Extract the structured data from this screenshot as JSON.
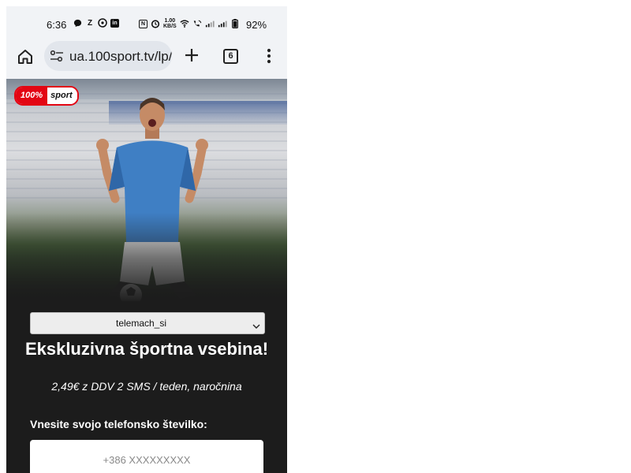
{
  "status_bar": {
    "time": "6:36",
    "net_speed_value": "1.00",
    "net_speed_unit": "KB/S",
    "battery_percent": "92%"
  },
  "browser": {
    "url": "ua.100sport.tv/lp/",
    "tab_count": "6"
  },
  "brand": {
    "logo_part1": "100%",
    "logo_part2": "sport",
    "accent_color": "#e30613"
  },
  "form": {
    "operator_selected": "telemach_si",
    "headline": "Ekskluzivna športna vsebina!",
    "price_text": "2,49€ z DDV 2 SMS / teden, naročnina",
    "phone_label": "Vnesite svojo telefonsko številko:",
    "phone_placeholder": "+386 XXXXXXXXX"
  }
}
